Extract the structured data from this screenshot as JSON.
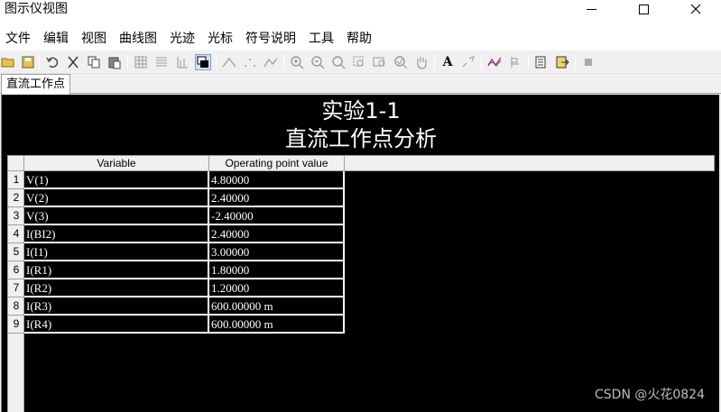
{
  "window": {
    "title": "图示仪视图"
  },
  "menu": [
    "文件",
    "编辑",
    "视图",
    "曲线图",
    "光迹",
    "光标",
    "符号说明",
    "工具",
    "帮助"
  ],
  "toolbar_icons": [
    "open-folder-icon",
    "save-icon",
    "undo-icon",
    "cut-icon",
    "copy-icon",
    "paste-icon",
    "grid-icon",
    "list-icon",
    "axis-icon",
    "print-window-icon",
    "curve-peak-icon",
    "curve-dots-icon",
    "curve-valley-icon",
    "zoom-in-icon",
    "zoom-out-icon",
    "zoom-fit-icon",
    "zoom-area-icon",
    "zoom-window-icon",
    "zoom-custom-icon",
    "pan-hand-icon",
    "text-icon",
    "marker-icon",
    "trace-icon",
    "cursor-icon",
    "export-icon",
    "import-icon",
    "stop-icon"
  ],
  "tab": {
    "label": "直流工作点"
  },
  "analysis": {
    "title_line1": "实验1-1",
    "title_line2": "直流工作点分析"
  },
  "table": {
    "headers": [
      "Variable",
      "Operating point value"
    ],
    "rows": [
      {
        "num": "1",
        "variable": "V(1)",
        "value": "4.80000"
      },
      {
        "num": "2",
        "variable": "V(2)",
        "value": "2.40000"
      },
      {
        "num": "3",
        "variable": "V(3)",
        "value": "-2.40000"
      },
      {
        "num": "4",
        "variable": "I(BI2)",
        "value": "2.40000"
      },
      {
        "num": "5",
        "variable": "I(I1)",
        "value": "3.00000"
      },
      {
        "num": "6",
        "variable": "I(R1)",
        "value": "1.80000"
      },
      {
        "num": "7",
        "variable": "I(R2)",
        "value": "1.20000"
      },
      {
        "num": "8",
        "variable": "I(R3)",
        "value": "600.00000 m"
      },
      {
        "num": "9",
        "variable": "I(R4)",
        "value": "600.00000 m"
      }
    ]
  },
  "watermark": "CSDN @火花0824",
  "colors": {
    "plot_background": "#000000",
    "text": "#ffffff",
    "chrome": "#f0f0f0"
  }
}
